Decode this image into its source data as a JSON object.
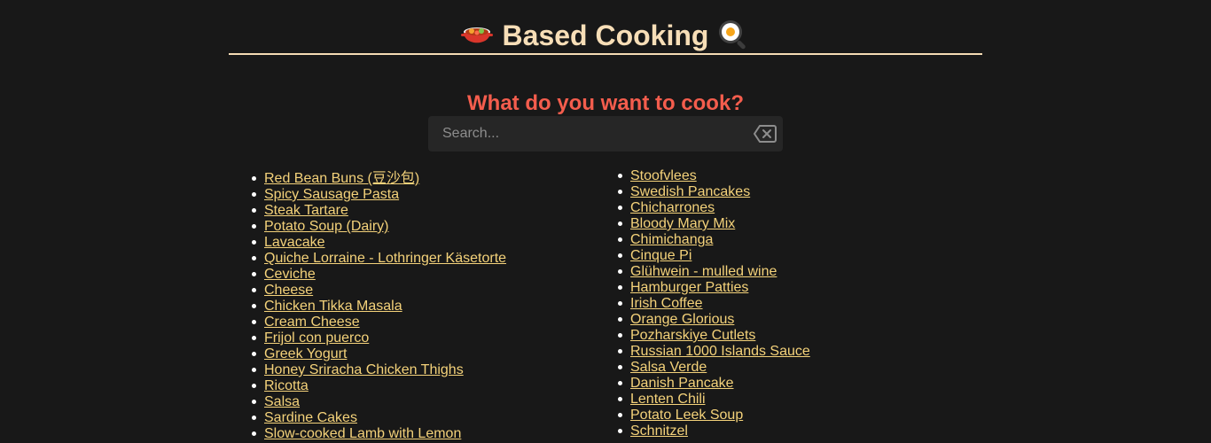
{
  "site": {
    "title": "Based Cooking",
    "prompt": "What do you want to cook?"
  },
  "search": {
    "placeholder": "Search...",
    "value": ""
  },
  "icons": {
    "title_left": "cooking-pot-icon",
    "title_right": "frying-pan-egg-icon",
    "search_clear": "clear-search-icon"
  },
  "colors": {
    "background": "#181818",
    "title": "#f7deb7",
    "prompt": "#f45d4d",
    "link": "#f4d27a",
    "search_background": "#262626"
  },
  "recipes": {
    "left": [
      "Red Bean Buns (豆沙包)",
      "Spicy Sausage Pasta",
      "Steak Tartare",
      "Potato Soup (Dairy)",
      "Lavacake",
      "Quiche Lorraine - Lothringer Käsetorte",
      "Ceviche",
      "Cheese",
      "Chicken Tikka Masala",
      "Cream Cheese",
      "Frijol con puerco",
      "Greek Yogurt",
      "Honey Sriracha Chicken Thighs",
      "Ricotta",
      "Salsa",
      "Sardine Cakes",
      "Slow-cooked Lamb with Lemon"
    ],
    "right": [
      "Stoofvlees",
      "Swedish Pancakes",
      "Chicharrones",
      "Bloody Mary Mix",
      "Chimichanga",
      "Cinque Pi",
      "Glühwein - mulled wine",
      "Hamburger Patties",
      "Irish Coffee",
      "Orange Glorious",
      "Pozharskiye Cutlets",
      "Russian 1000 Islands Sauce",
      "Salsa Verde",
      "Danish Pancake",
      "Lenten Chili",
      "Potato Leek Soup",
      "Schnitzel"
    ]
  }
}
